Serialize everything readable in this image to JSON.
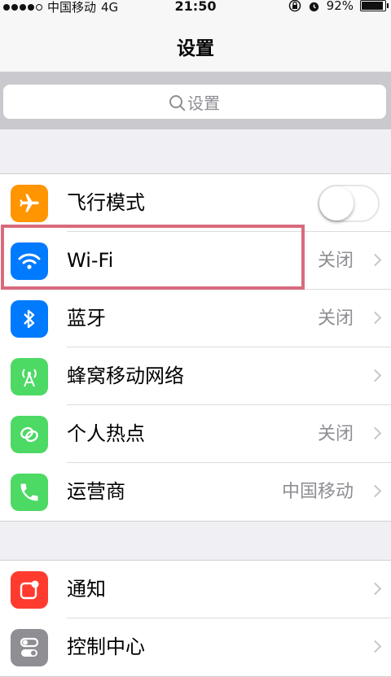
{
  "status": {
    "carrier": "中国移动",
    "network": "4G",
    "time": "21:50",
    "battery": "92%",
    "battery_level": 0.92
  },
  "nav": {
    "title": "设置"
  },
  "search": {
    "placeholder": "设置"
  },
  "group1": [
    {
      "label": "飞行模式",
      "icon": "airplane-icon",
      "color": "#ff9500",
      "control": "toggle",
      "on": false
    },
    {
      "label": "Wi-Fi",
      "icon": "wifi-icon",
      "color": "#007aff",
      "value": "关闭",
      "highlighted": true
    },
    {
      "label": "蓝牙",
      "icon": "bluetooth-icon",
      "color": "#007aff",
      "value": "关闭"
    },
    {
      "label": "蜂窝移动网络",
      "icon": "cellular-antenna-icon",
      "color": "#4cd964"
    },
    {
      "label": "个人热点",
      "icon": "hotspot-link-icon",
      "color": "#4cd964",
      "value": "关闭"
    },
    {
      "label": "运营商",
      "icon": "phone-icon",
      "color": "#4cd964",
      "value": "中国移动"
    }
  ],
  "group2": [
    {
      "label": "通知",
      "icon": "notification-icon",
      "color": "#ff3b30"
    },
    {
      "label": "控制中心",
      "icon": "control-center-icon",
      "color": "#8e8e93"
    }
  ],
  "colors": {
    "highlight": "#d76b7c",
    "background": "#efeff4"
  }
}
